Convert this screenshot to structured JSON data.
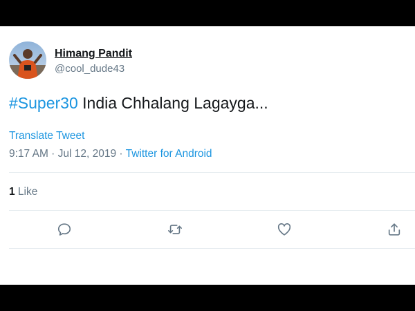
{
  "tweet": {
    "author_name": "Himang Pandit",
    "author_handle": "@cool_dude43",
    "hashtag": "#Super30",
    "text": " India Chhalang Lagayga...",
    "translate_label": "Translate Tweet",
    "time": "9:17 AM",
    "separator1": " · ",
    "date": "Jul 12, 2019",
    "separator2": " · ",
    "source": "Twitter for Android",
    "like_count": "1",
    "like_label": " Like"
  },
  "actions": [
    "reply-icon",
    "retweet-icon",
    "like-icon",
    "share-icon"
  ],
  "colors": {
    "link": "#1b95e0",
    "muted": "#657786",
    "text": "#14171a"
  }
}
